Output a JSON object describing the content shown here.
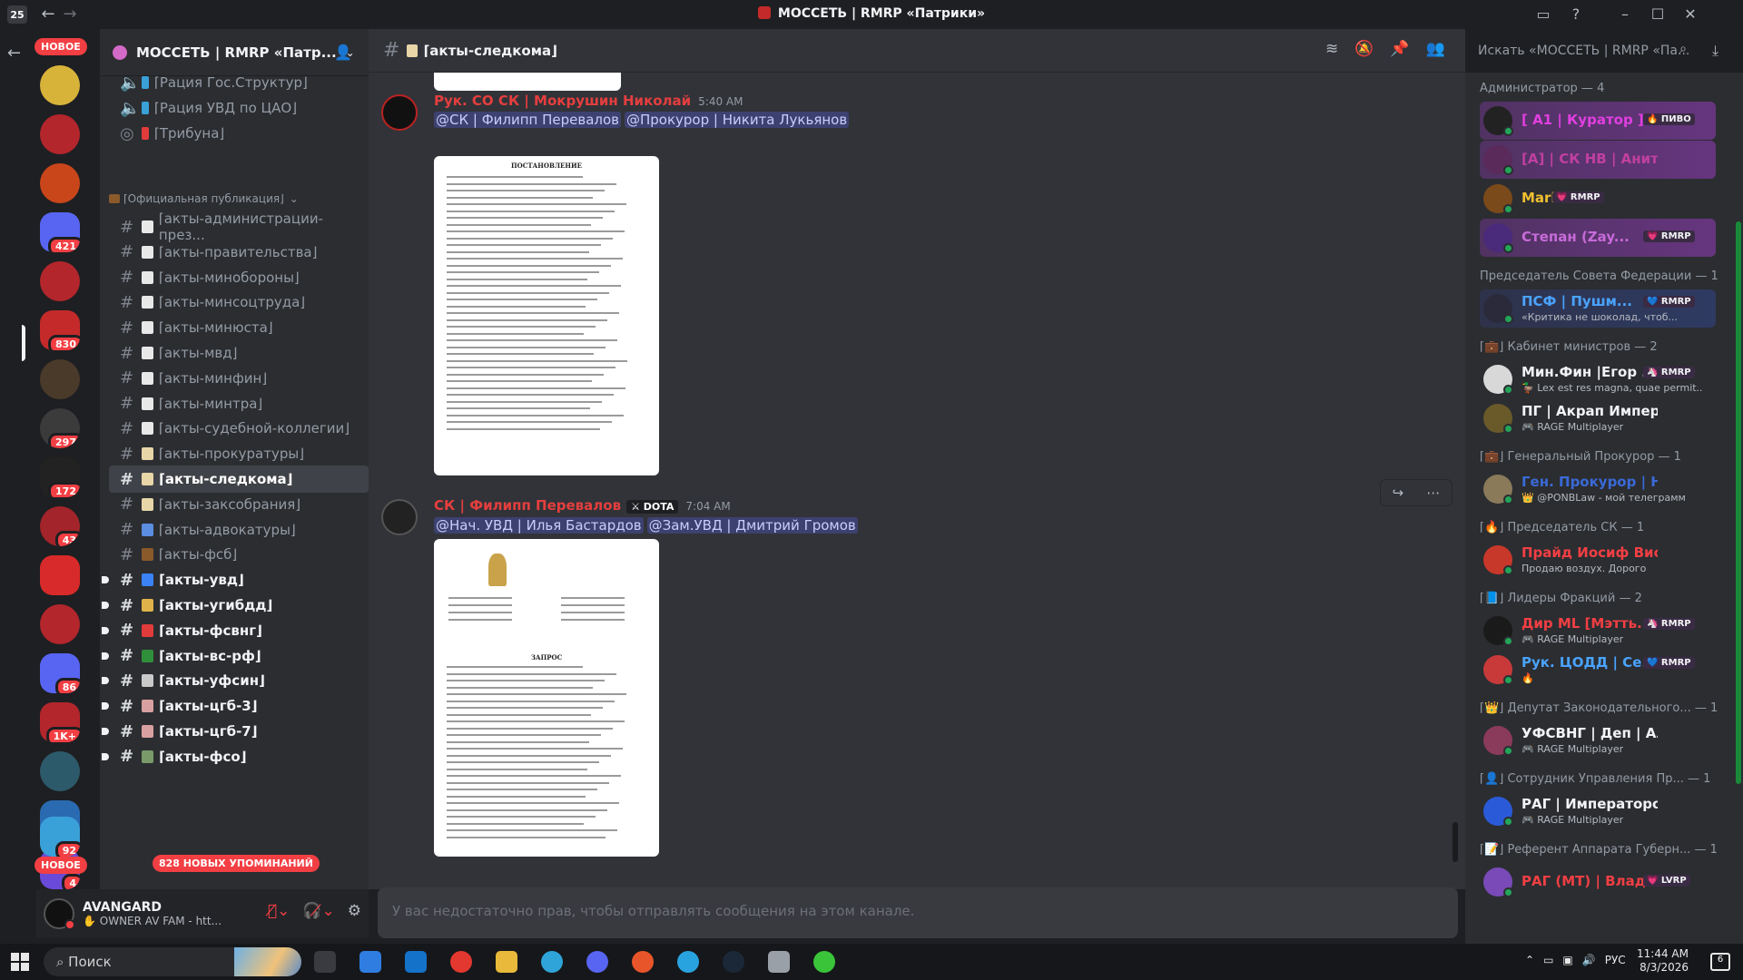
{
  "window": {
    "title": "МОССЕТЬ | RMRP «Патрики»",
    "app_badge": "25"
  },
  "servers": {
    "new_top": "НОВОЕ",
    "new_bottom": "НОВОЕ",
    "mentions_pill": "828 НОВЫХ УПОМИНАНИЙ",
    "badges": [
      "421",
      "830",
      "297",
      "172",
      "43",
      "86",
      "1K+",
      "4",
      "92"
    ]
  },
  "guild": {
    "name": "МОССЕТЬ | RMRP «Патр...",
    "voice_channels": [
      "⌈Рация Гос.Структур⌋",
      "⌈Рация УВД по ЦАО⌋",
      "⌈Трибуна⌋"
    ],
    "category": "⌈Официальная публикация⌋",
    "channels": [
      {
        "name": "⌈акты-администрации-през...",
        "color": "#e8e8e8",
        "state": "muted"
      },
      {
        "name": "⌈акты-правительства⌋",
        "color": "#e8e8e8",
        "state": "muted"
      },
      {
        "name": "⌈акты-минобороны⌋",
        "color": "#e8e8e8",
        "state": "muted"
      },
      {
        "name": "⌈акты-минсоцтруда⌋",
        "color": "#e8e8e8",
        "state": "muted"
      },
      {
        "name": "⌈акты-минюста⌋",
        "color": "#e8e8e8",
        "state": "muted"
      },
      {
        "name": "⌈акты-мвд⌋",
        "color": "#e8e8e8",
        "state": "muted"
      },
      {
        "name": "⌈акты-минфин⌋",
        "color": "#e8e8e8",
        "state": "muted"
      },
      {
        "name": "⌈акты-минтра⌋",
        "color": "#e8e8e8",
        "state": "muted"
      },
      {
        "name": "⌈акты-судебной-коллегии⌋",
        "color": "#e8e8e8",
        "state": "muted"
      },
      {
        "name": "⌈акты-прокуратуры⌋",
        "color": "#e8d6a8",
        "state": "muted"
      },
      {
        "name": "⌈акты-следкома⌋",
        "color": "#e8d6a8",
        "state": "selected"
      },
      {
        "name": "⌈акты-заксобрания⌋",
        "color": "#e8d6a8",
        "state": "muted"
      },
      {
        "name": "⌈акты-адвокатуры⌋",
        "color": "#5b8de0",
        "state": "muted"
      },
      {
        "name": "⌈акты-фсб⌋",
        "color": "#8a5a2b",
        "state": "muted"
      },
      {
        "name": "⌈акты-увд⌋",
        "color": "#3b82f6",
        "state": "unread"
      },
      {
        "name": "⌈акты-угибдд⌋",
        "color": "#e0b34a",
        "state": "unread"
      },
      {
        "name": "⌈акты-фсвнг⌋",
        "color": "#e23b3b",
        "state": "unread"
      },
      {
        "name": "⌈акты-вс-рф⌋",
        "color": "#2f8f3a",
        "state": "unread"
      },
      {
        "name": "⌈акты-уфсин⌋",
        "color": "#c9c9c9",
        "state": "unread"
      },
      {
        "name": "⌈акты-цгб-3⌋",
        "color": "#d8a0a0",
        "state": "unread"
      },
      {
        "name": "⌈акты-цгб-7⌋",
        "color": "#d8a0a0",
        "state": "unread"
      },
      {
        "name": "⌈акты-фсо⌋",
        "color": "#7a9a6a",
        "state": "unread"
      }
    ]
  },
  "user": {
    "name": "AVANGARD",
    "status": "✋ OWNER AV FAM - htt..."
  },
  "channel_header": {
    "name": "⌈акты-следкома⌋",
    "search_placeholder": "Искать «МОССЕТЬ | RMRP «Па..."
  },
  "messages": [
    {
      "author": "Рук. СО СК | Мокрушин Николай",
      "time": "5:40 AM",
      "mentions": [
        "@СК | Филипп Перевалов",
        "@Прокурор | Никита Лукьянов"
      ],
      "doc_title": "ПОСТАНОВЛЕНИЕ"
    },
    {
      "author": "СК | Филипп Перевалов",
      "tag": "DOTA",
      "time": "7:04 AM",
      "mentions": [
        "@Нач. УВД | Илья Бастардов",
        "@Зам.УВД | Дмитрий Громов"
      ],
      "doc_title": "ЗАПРОС"
    }
  ],
  "composer": {
    "text": "У вас недостаточно прав, чтобы отправлять сообщения на этом канале."
  },
  "members": {
    "groups": [
      {
        "title": "Администратор — 4",
        "items": [
          {
            "name": "[ A1 | Куратор ] ...",
            "color": "#e03fe0",
            "tag": "🔥 ПИВО",
            "sub": "",
            "boost": "purple"
          },
          {
            "name": "[А] | СК НВ | Анита (Н...",
            "color": "#c040a0",
            "tag": "",
            "sub": "",
            "boost": "purple"
          },
          {
            "name": "Mark",
            "color": "#f0c030",
            "tag": "💗 RMRP",
            "sub": "",
            "boost": ""
          },
          {
            "name": "Степан (Zay...",
            "color": "#c76bd8",
            "tag": "💗 RMRP",
            "sub": "",
            "boost": "purple"
          }
        ]
      },
      {
        "title": "Председатель Совета Федерации — 1",
        "items": [
          {
            "name": "ПСФ | Пушм...",
            "color": "#4aa3ff",
            "tag": "💙 RMRP",
            "sub": "«Критика не шоколад, чтоб...",
            "boost": "blue"
          }
        ]
      },
      {
        "title": "⌈💼⌋ Кабинет министров — 2",
        "items": [
          {
            "name": "Мин.Фин |Егор ...",
            "color": "#f2f3f5",
            "tag": "🦄 RMRP",
            "sub": "🦆 Lex est res magna, quae permit...",
            "boost": ""
          },
          {
            "name": "ПГ | Акрап Императоров",
            "color": "#f2f3f5",
            "tag": "",
            "sub": "🎮 RAGE Multiplayer",
            "boost": ""
          }
        ]
      },
      {
        "title": "⌈💼⌋ Генеральный Прокурор — 1",
        "items": [
          {
            "name": "Ген. Прокурор | Никит...",
            "color": "#3a6ad8",
            "tag": "",
            "sub": "👑 @PONBLaw - мой телеграмм",
            "boost": ""
          }
        ]
      },
      {
        "title": "⌈🔥⌋ Председатель СК — 1",
        "items": [
          {
            "name": "Прайд Иосиф Виссарио...",
            "color": "#f23f43",
            "tag": "",
            "sub": "Продаю воздух. Дорого",
            "boost": ""
          }
        ]
      },
      {
        "title": "⌈📘⌋ Лидеры Фракций — 2",
        "items": [
          {
            "name": "Дир ML [Мэтть...",
            "color": "#f23f43",
            "tag": "🦄 RMRP",
            "sub": "🎮 RAGE Multiplayer",
            "boost": ""
          },
          {
            "name": "Рук. ЦОДД | Се...",
            "color": "#4aa3ff",
            "tag": "💙 RMRP",
            "sub": "🔥",
            "boost": ""
          }
        ]
      },
      {
        "title": "⌈👑⌋ Депутат Законодательного... — 1",
        "items": [
          {
            "name": "УФСВНГ | Деп | Алексан...",
            "color": "#f2f3f5",
            "tag": "",
            "sub": "🎮 RAGE Multiplayer",
            "boost": ""
          }
        ]
      },
      {
        "title": "⌈👤⌋ Сотрудник Управления Пр... — 1",
        "items": [
          {
            "name": "РАГ | Императорова Кар...",
            "color": "#f2f3f5",
            "tag": "",
            "sub": "🎮 RAGE Multiplayer",
            "boost": ""
          }
        ]
      },
      {
        "title": "⌈📝⌋ Референт Аппарата Губерн... — 1",
        "items": [
          {
            "name": "РАГ (МТ) | Влад...",
            "color": "#f23f43",
            "tag": "💗 LVRP",
            "sub": "",
            "boost": ""
          }
        ]
      }
    ]
  },
  "taskbar": {
    "search": "Поиск",
    "lang": "РУС",
    "time": "11:44 AM",
    "date": "8/3/2026",
    "notif": "6"
  }
}
